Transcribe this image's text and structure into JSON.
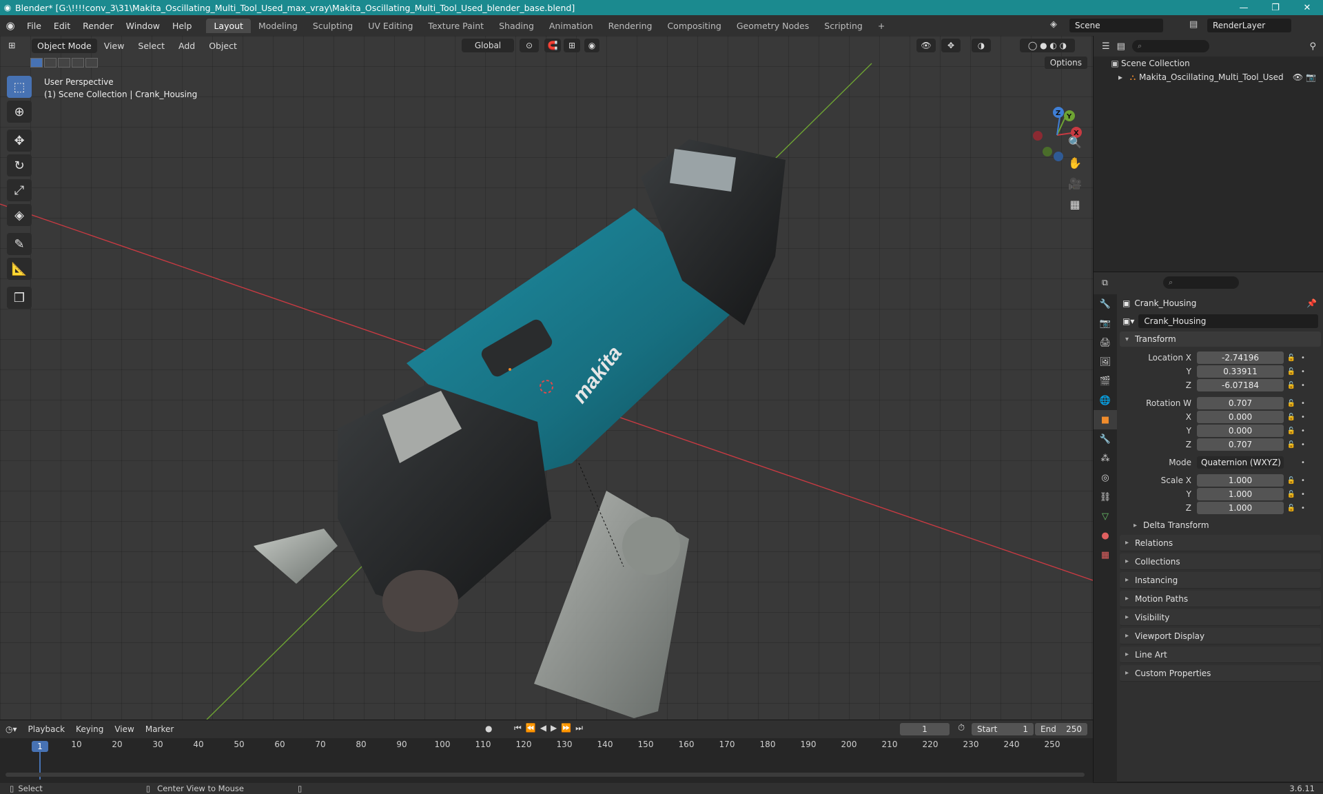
{
  "window": {
    "title": "Blender* [G:\\!!!!conv_3\\31\\Makita_Oscillating_Multi_Tool_Used_max_vray\\Makita_Oscillating_Multi_Tool_Used_blender_base.blend]"
  },
  "menu": [
    "File",
    "Edit",
    "Render",
    "Window",
    "Help"
  ],
  "workspaces": [
    "Layout",
    "Modeling",
    "Sculpting",
    "UV Editing",
    "Texture Paint",
    "Shading",
    "Animation",
    "Rendering",
    "Compositing",
    "Geometry Nodes",
    "Scripting"
  ],
  "active_workspace": "Layout",
  "scene": {
    "name": "Scene",
    "view_layer": "RenderLayer"
  },
  "viewport": {
    "mode": "Object Mode",
    "menus": [
      "View",
      "Select",
      "Add",
      "Object"
    ],
    "orientation": "Global",
    "info_line1": "User Perspective",
    "info_line2": "(1) Scene Collection | Crank_Housing",
    "options_label": "Options",
    "gizmo_axes": [
      "X",
      "Y",
      "Z"
    ],
    "brand_text": "makita"
  },
  "outliner": {
    "root": "Scene Collection",
    "items": [
      "Makita_Oscillating_Multi_Tool_Used"
    ]
  },
  "properties": {
    "object_name": "Crank_Housing",
    "data_name": "Crank_Housing",
    "transform_title": "Transform",
    "location": {
      "label": "Location X",
      "x": "-2.74196",
      "y": "0.33911",
      "z": "-6.07184"
    },
    "rotation": {
      "label": "Rotation W",
      "w": "0.707",
      "x": "0.000",
      "y": "0.000",
      "z": "0.707"
    },
    "mode": {
      "label": "Mode",
      "value": "Quaternion (WXYZ)"
    },
    "scale": {
      "label": "Scale X",
      "x": "1.000",
      "y": "1.000",
      "z": "1.000"
    },
    "axis_labels": {
      "y": "Y",
      "z": "Z",
      "x": "X"
    },
    "delta_transform": "Delta Transform",
    "panels": [
      "Relations",
      "Collections",
      "Instancing",
      "Motion Paths",
      "Visibility",
      "Viewport Display",
      "Line Art",
      "Custom Properties"
    ]
  },
  "timeline": {
    "menus": [
      "Playback",
      "Keying",
      "View",
      "Marker"
    ],
    "current_frame": "1",
    "start_label": "Start",
    "start": "1",
    "end_label": "End",
    "end": "250",
    "ticks": [
      "10",
      "20",
      "30",
      "40",
      "50",
      "60",
      "70",
      "80",
      "90",
      "100",
      "110",
      "120",
      "130",
      "140",
      "150",
      "160",
      "170",
      "180",
      "190",
      "200",
      "210",
      "220",
      "230",
      "240",
      "250"
    ]
  },
  "status": {
    "select": "Select",
    "center_view": "Center View to Mouse",
    "version": "3.6.11"
  },
  "colors": {
    "accent": "#4772b3",
    "titlebar": "#1b8a8f",
    "x_axis": "#c83a42",
    "y_axis": "#6ea433",
    "z_axis": "#3f7fd6",
    "tool_body": "#1a8aa0"
  }
}
